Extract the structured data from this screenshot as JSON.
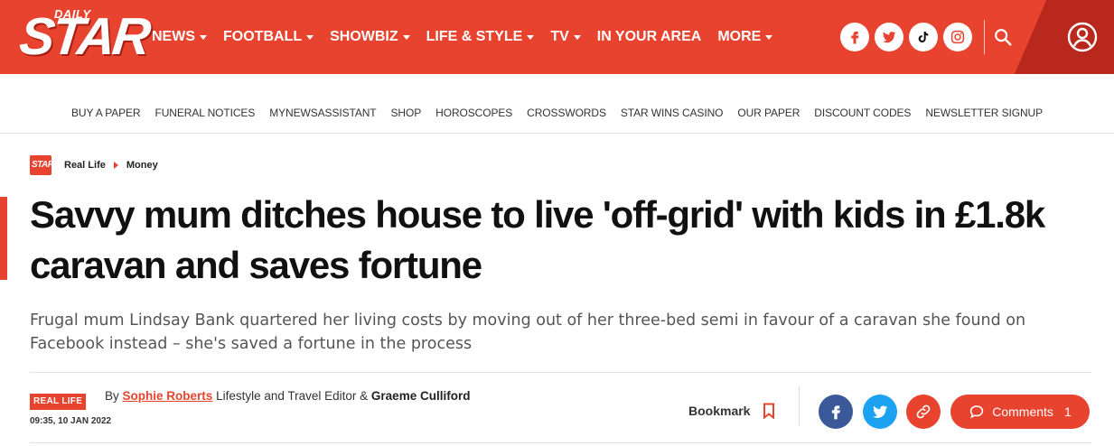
{
  "brand": {
    "daily": "DAILY",
    "star": "STAR",
    "mini": "STAR"
  },
  "colors": {
    "brand_red": "#e8432e",
    "dark_red": "#b8281c",
    "facebook": "#3b5998",
    "twitter": "#1da1f2"
  },
  "nav": {
    "items": [
      {
        "label": "NEWS",
        "caret": true
      },
      {
        "label": "FOOTBALL",
        "caret": true
      },
      {
        "label": "SHOWBIZ",
        "caret": true
      },
      {
        "label": "LIFE & STYLE",
        "caret": true
      },
      {
        "label": "TV",
        "caret": true
      },
      {
        "label": "IN YOUR AREA",
        "caret": false
      },
      {
        "label": "MORE",
        "caret": true
      }
    ],
    "social_icons": [
      "facebook-icon",
      "twitter-icon",
      "tiktok-icon",
      "instagram-icon"
    ],
    "search_icon": "search-icon",
    "account_icon": "account-icon"
  },
  "subnav": {
    "items": [
      "BUY A PAPER",
      "FUNERAL NOTICES",
      "MYNEWSASSISTANT",
      "SHOP",
      "HOROSCOPES",
      "CROSSWORDS",
      "STAR WINS CASINO",
      "OUR PAPER",
      "DISCOUNT CODES",
      "NEWSLETTER SIGNUP"
    ]
  },
  "breadcrumb": {
    "level1": "Real Life",
    "level2": "Money"
  },
  "article": {
    "headline": "Savvy mum ditches house to live 'off-grid' with kids in £1.8k caravan and saves fortune",
    "standfirst": "Frugal mum Lindsay Bank quartered her living costs by moving out of her three-bed semi in favour of a caravan she found on Facebook instead – she's saved a fortune in the process",
    "tag": "REAL LIFE",
    "date": "09:35, 10 JAN 2022",
    "byline": {
      "by": "By",
      "author1": "Sophie Roberts",
      "role1": "Lifestyle and Travel Editor &",
      "author2": "Graeme Culliford"
    }
  },
  "actions": {
    "bookmark_label": "Bookmark",
    "comments_label": "Comments",
    "comments_count": "1"
  }
}
